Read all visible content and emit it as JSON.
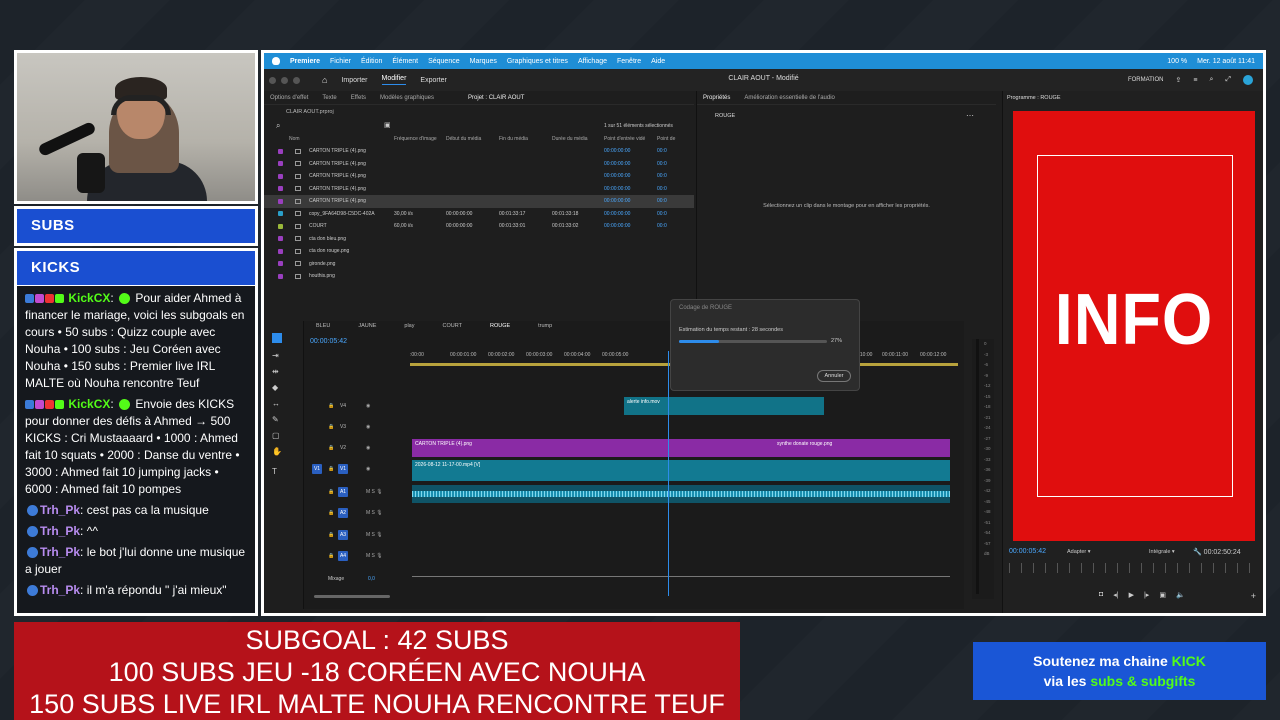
{
  "chat_sidebar": {
    "subs_label": "SUBS",
    "kicks_label": "KICKS",
    "messages": [
      {
        "user": "KickCX",
        "text": "Pour aider Ahmed à financer le mariage, voici les subgoals en cours • 50 subs : Quizz couple avec Nouha • 100 subs : Jeu   Coréen avec Nouha • 150 subs : Premier live IRL MALTE où Nouha rencontre Teuf"
      },
      {
        "user": "KickCX",
        "text": "Envoie des KICKS pour donner des défis à Ahmed → 500 KICKS : Cri Mustaaaard • 1000 : Ahmed fait 10 squats • 2000 : Danse du ventre • 3000 : Ahmed fait 10 jumping jacks • 6000 : Ahmed fait 10 pompes"
      },
      {
        "user": "Trh_Pk",
        "text": "cest pas ca la musique"
      },
      {
        "user": "Trh_Pk",
        "text": "^^"
      },
      {
        "user": "Trh_Pk",
        "text": "le bot j'lui donne une musique a jouer"
      },
      {
        "user": "Trh_Pk",
        "text": "il m'a répondu \" j'ai mieux\""
      }
    ]
  },
  "premiere": {
    "menubar": [
      "Premiere",
      "Fichier",
      "Édition",
      "Élément",
      "Séquence",
      "Marques",
      "Graphiques et titres",
      "Affichage",
      "Fenêtre",
      "Aide"
    ],
    "menubar_right": {
      "battery": "100 %",
      "datetime": "Mer. 12 août  11:41"
    },
    "top_tabs": [
      "Importer",
      "Modifier",
      "Exporter"
    ],
    "window_title": "CLAIR AOUT - Modifié",
    "workspace": "FORMATION",
    "left_panel_tabs": [
      "Options d'effet",
      "Texte",
      "Effets",
      "Modèles graphiques",
      "Projet : CLAIR AOUT"
    ],
    "project_file": "CLAIR AOUT.prproj",
    "selection_count": "1 sur 51 éléments sélectionnés",
    "columns": [
      "Nom",
      "Fréquence d'image",
      "Début du média",
      "Fin du média",
      "Durée du média",
      "Point d'entrée vidé",
      "Point de"
    ],
    "items": [
      {
        "name": "CARTON TRIPLE (4).png",
        "fps": "",
        "start": "",
        "end": "",
        "dur": "",
        "in": "00:00:00:00",
        "pt": "00:0",
        "color": "#9a3fbf"
      },
      {
        "name": "CARTON TRIPLE (4).png",
        "fps": "",
        "start": "",
        "end": "",
        "dur": "",
        "in": "00:00:00:00",
        "pt": "00:0",
        "color": "#9a3fbf"
      },
      {
        "name": "CARTON TRIPLE (4).png",
        "fps": "",
        "start": "",
        "end": "",
        "dur": "",
        "in": "00:00:00:00",
        "pt": "00:0",
        "color": "#9a3fbf"
      },
      {
        "name": "CARTON TRIPLE (4).png",
        "fps": "",
        "start": "",
        "end": "",
        "dur": "",
        "in": "00:00:00:00",
        "pt": "00:0",
        "color": "#9a3fbf"
      },
      {
        "name": "CARTON TRIPLE (4).png",
        "fps": "",
        "start": "",
        "end": "",
        "dur": "",
        "in": "00:00:00:00",
        "pt": "00:0",
        "color": "#9a3fbf"
      },
      {
        "name": "copy_9FA64D98-C5DC-402A",
        "fps": "30,00 i/s",
        "start": "00:00:00:00",
        "end": "00:01:33:17",
        "dur": "00:01:33:18",
        "in": "00:00:00:00",
        "pt": "00:0",
        "color": "#2a9fc8"
      },
      {
        "name": "COURT",
        "fps": "60,00 i/s",
        "start": "00:00:00:00",
        "end": "00:01:33:01",
        "dur": "00:01:33:02",
        "in": "00:00:00:00",
        "pt": "00:0",
        "color": "#9ab83a"
      },
      {
        "name": "cta don bleu.png",
        "fps": "",
        "start": "",
        "end": "",
        "dur": "",
        "in": "",
        "pt": "",
        "color": "#9a3fbf"
      },
      {
        "name": "cta don rouge.png",
        "fps": "",
        "start": "",
        "end": "",
        "dur": "",
        "in": "",
        "pt": "",
        "color": "#9a3fbf"
      },
      {
        "name": "gironde.png",
        "fps": "",
        "start": "",
        "end": "",
        "dur": "",
        "in": "",
        "pt": "",
        "color": "#9a3fbf"
      },
      {
        "name": "houthis.png",
        "fps": "",
        "start": "",
        "end": "",
        "dur": "",
        "in": "",
        "pt": "",
        "color": "#9a3fbf"
      }
    ],
    "props_tabs": [
      "Propriétés",
      "Amélioration essentielle de l'audio"
    ],
    "props_clip": "ROUGE",
    "props_hint": "Sélectionnez un clip dans le montage pour en afficher les propriétés.",
    "render_dialog": {
      "title": "Codage de ROUGE",
      "estimate": "Estimation du temps restant : 28 secondes",
      "percent": "27%",
      "progress": 0.27,
      "cancel": "Annuler"
    },
    "sequence_tabs": [
      "BLEU",
      "JAUNE",
      "play",
      "COURT",
      "ROUGE",
      "trump"
    ],
    "timecode": "00:00:05:42",
    "ruler": [
      ":00:00",
      "00:00:01:00",
      "00:00:02:00",
      "00:00:03:00",
      "00:00:04:00",
      "00:00:05:00",
      "00:00:10:00",
      "00:00:11:00",
      "00:00:12:00"
    ],
    "tracks": [
      "V4",
      "V3",
      "V2",
      "V1",
      "A1",
      "A2",
      "A3",
      "A4"
    ],
    "mix_label": "Mixage",
    "mix_value": "0,0",
    "clips": {
      "v4": "alerte info.mov",
      "v2a": "CARTON TRIPLE (4).png",
      "v2b": "synthe donate rouge.png",
      "v1": "2026-08-12 11-17-00.mp4 [V]"
    },
    "program": {
      "title": "Programme : ROUGE",
      "frame_text": "INFO",
      "timecode": "00:00:05:42",
      "fit": "Adapter",
      "quality": "Intégrale",
      "duration": "00:02:50:24"
    }
  },
  "overlays": {
    "subgoal_lines": [
      "SUBGOAL : 42 SUBS",
      "100 SUBS JEU -18 CORÉEN AVEC NOUHA",
      "150 SUBS LIVE IRL MALTE NOUHA RENCONTRE TEUF"
    ],
    "kick_line1_a": "Soutenez ma chaine",
    "kick_brand": "KICK",
    "kick_line2_a": "via les",
    "kick_line2_b": "subs & subgifts"
  },
  "colors": {
    "kick_green": "#53fc18",
    "premiere_blue": "#1f8ed6",
    "sub_red": "#b5121a",
    "overlay_blue": "#1a56d6"
  }
}
